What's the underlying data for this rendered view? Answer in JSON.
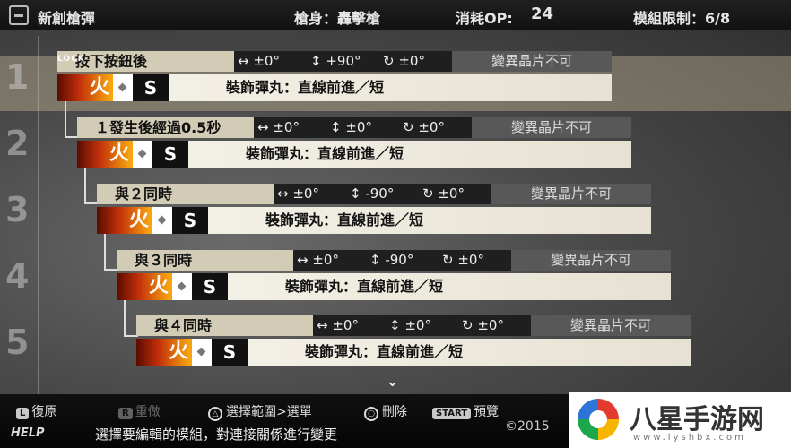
{
  "header": {
    "title": "新創槍彈",
    "gun_label": "槍身：轟擊槍",
    "op_label": "消耗OP:",
    "op_value": "24",
    "limit_label": "模組限制：6/8"
  },
  "lock_label": "LOCK",
  "row_numbers": [
    "1",
    "2",
    "3",
    "4",
    "5"
  ],
  "rows": [
    {
      "condition": "按下按鈕後",
      "h": "↔ ±0°",
      "v": "↕ +90°",
      "r": "↻ ±0°",
      "note": "變異晶片不可",
      "element": "火",
      "size": "S",
      "bullet": "裝飾彈丸：直線前進／短"
    },
    {
      "condition": "１發生後經過0.5秒",
      "h": "↔ ±0°",
      "v": "↕ ±0°",
      "r": "↻ ±0°",
      "note": "變異晶片不可",
      "element": "火",
      "size": "S",
      "bullet": "裝飾彈丸：直線前進／短"
    },
    {
      "condition": "與２同時",
      "h": "↔ ±0°",
      "v": "↕ -90°",
      "r": "↻ ±0°",
      "note": "變異晶片不可",
      "element": "火",
      "size": "S",
      "bullet": "裝飾彈丸：直線前進／短"
    },
    {
      "condition": "與３同時",
      "h": "↔ ±0°",
      "v": "↕ -90°",
      "r": "↻ ±0°",
      "note": "變異晶片不可",
      "element": "火",
      "size": "S",
      "bullet": "裝飾彈丸：直線前進／短"
    },
    {
      "condition": "與４同時",
      "h": "↔ ±0°",
      "v": "↕ ±0°",
      "r": "↻ ±0°",
      "note": "變異晶片不可",
      "element": "火",
      "size": "S",
      "bullet": "裝飾彈丸：直線前進／短"
    }
  ],
  "controls": {
    "undo_key": "L",
    "undo": "復原",
    "redo_key": "R",
    "redo": "重做",
    "select_key": "△",
    "select": "選擇範圍>選單",
    "delete_key": "○",
    "delete": "刪除",
    "preview_key": "START",
    "preview": "預覽"
  },
  "help_label": "HELP",
  "hint": "選擇要編輯的模組，對連接關係進行變更",
  "copyright": "©2015",
  "watermark": {
    "title": "八星手游网",
    "url": "www.lyshbx.com"
  },
  "colors": {
    "accent": "#c2300a",
    "panel": "#d2ccb6"
  }
}
